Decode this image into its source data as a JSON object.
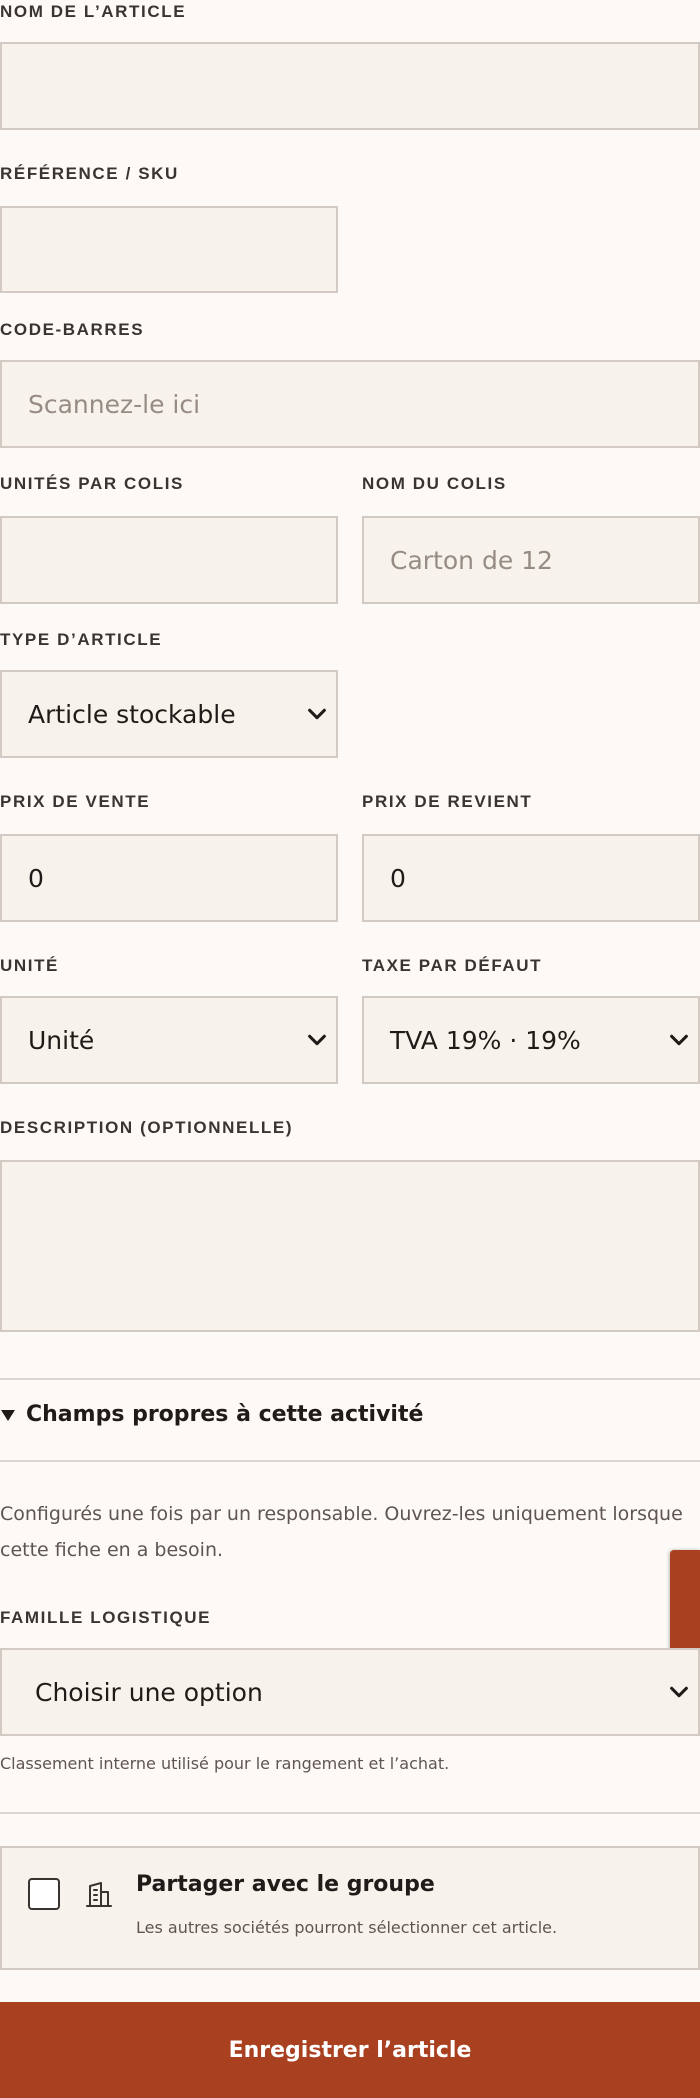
{
  "form": {
    "name_label": "NOM DE L’ARTICLE",
    "name_value": "",
    "sku_label": "RÉFÉRENCE / SKU",
    "sku_value": "",
    "barcode_label": "CODE-BARRES",
    "barcode_placeholder": "Scannez-le ici",
    "units_per_pack_label": "UNITÉS PAR COLIS",
    "units_per_pack_value": "",
    "pack_name_label": "NOM DU COLIS",
    "pack_name_placeholder": "Carton de 12",
    "type_label": "TYPE D’ARTICLE",
    "type_value": "Article stockable",
    "sale_price_label": "PRIX DE VENTE",
    "sale_price_value": "0",
    "cost_price_label": "PRIX DE REVIENT",
    "cost_price_value": "0",
    "unit_label": "UNITÉ",
    "unit_value": "Unité",
    "tax_label": "TAXE PAR DÉFAUT",
    "tax_value": "TVA 19% · 19%",
    "description_label": "DESCRIPTION (OPTIONNELLE)",
    "description_value": ""
  },
  "custom_fields": {
    "summary": "Champs propres à cette activité",
    "help": "Configurés une fois par un responsable. Ouvrez-les uniquement lorsque cette fiche en a besoin.",
    "family_label": "FAMILLE LOGISTIQUE",
    "family_value": "Choisir une option",
    "family_hint": "Classement interne utilisé pour le rangement et l’achat."
  },
  "share": {
    "title": "Partager avec le groupe",
    "subtitle": "Les autres sociétés pourront sélectionner cet article.",
    "checked": false
  },
  "actions": {
    "save_label": "Enregistrer l’article"
  },
  "theme": {
    "accent": "#a9401f",
    "field_bg": "#f7f2ec",
    "border": "#d3cac3",
    "page_bg": "#fdf9f7"
  },
  "icons": {
    "select_arrow": "chevron-down-icon",
    "share": "building-icon",
    "disclosure": "triangle-down-icon"
  }
}
